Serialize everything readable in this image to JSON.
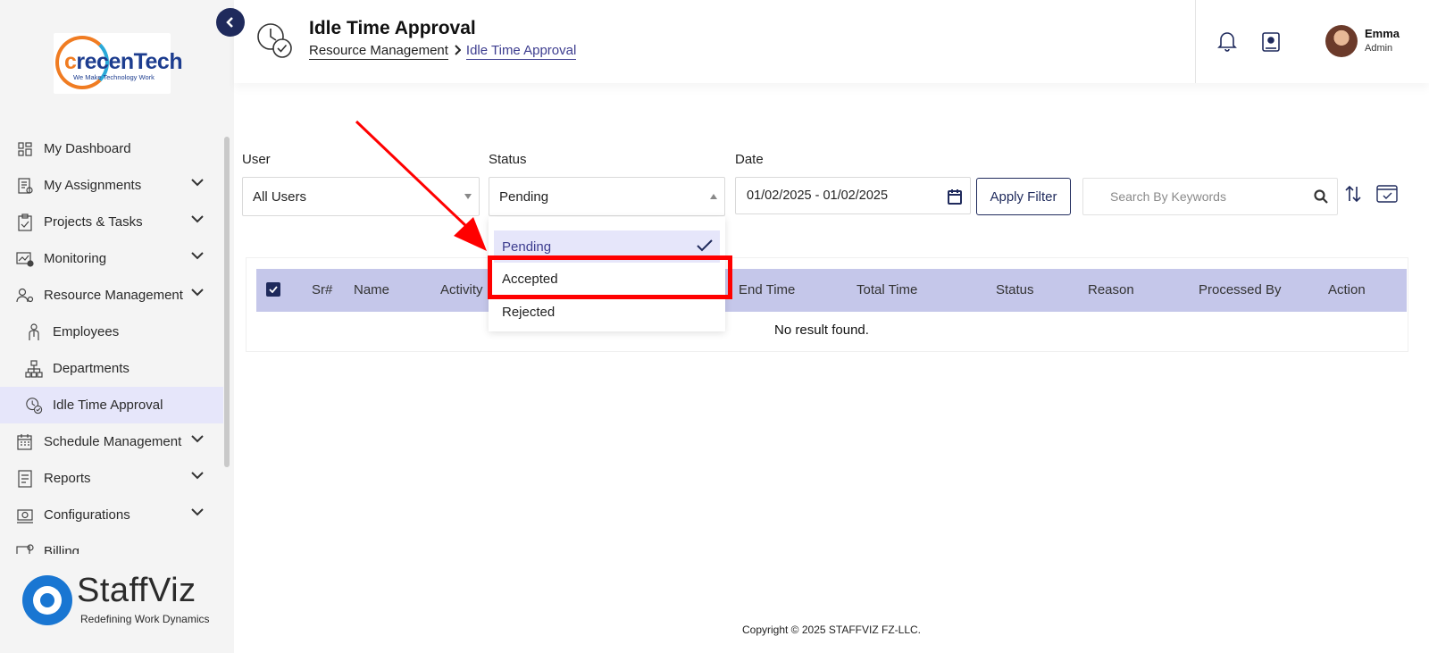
{
  "sidebar": {
    "logo": {
      "brand_prefix": "c",
      "brand_rest": "recenTech",
      "tagline": "We Make Technology Work"
    },
    "items": [
      {
        "label": "My Dashboard",
        "icon": "dashboard-icon"
      },
      {
        "label": "My Assignments",
        "icon": "assignments-icon"
      },
      {
        "label": "Projects & Tasks",
        "icon": "projects-icon"
      },
      {
        "label": "Monitoring",
        "icon": "monitoring-icon"
      },
      {
        "label": "Resource Management",
        "icon": "resource-icon"
      },
      {
        "label": "Employees",
        "icon": "employee-icon"
      },
      {
        "label": "Departments",
        "icon": "departments-icon"
      },
      {
        "label": "Idle Time Approval",
        "icon": "idle-time-icon"
      },
      {
        "label": "Schedule Management",
        "icon": "schedule-icon"
      },
      {
        "label": "Reports",
        "icon": "reports-icon"
      },
      {
        "label": "Configurations",
        "icon": "configurations-icon"
      },
      {
        "label": "Billing",
        "icon": "billing-icon"
      }
    ],
    "footer_brand": {
      "name": "StaffViz",
      "tagline": "Redefining Work Dynamics"
    }
  },
  "header": {
    "title": "Idle Time Approval",
    "breadcrumb": {
      "parent": "Resource Management",
      "separator": ">",
      "current": "Idle Time Approval"
    },
    "user": {
      "name": "Emma",
      "role": "Admin"
    }
  },
  "filters": {
    "user": {
      "label": "User",
      "value": "All Users"
    },
    "status": {
      "label": "Status",
      "value": "Pending",
      "options": [
        "Pending",
        "Accepted",
        "Rejected"
      ]
    },
    "date": {
      "label": "Date",
      "value": "01/02/2025 - 01/02/2025"
    },
    "apply_label": "Apply Filter",
    "search_placeholder": "Search By Keywords"
  },
  "table": {
    "columns": [
      "Sr#",
      "Name",
      "Activity",
      "End Time",
      "Total Time",
      "Status",
      "Reason",
      "Processed By",
      "Action"
    ],
    "empty_message": "No result found."
  },
  "footer": {
    "copyright": "Copyright © 2025 STAFFVIZ FZ-LLC."
  },
  "colors": {
    "accent": "#1f2a5c",
    "table_header": "#c5c7ea",
    "active_item": "#e6e6fa",
    "annotation": "#ff0000"
  }
}
